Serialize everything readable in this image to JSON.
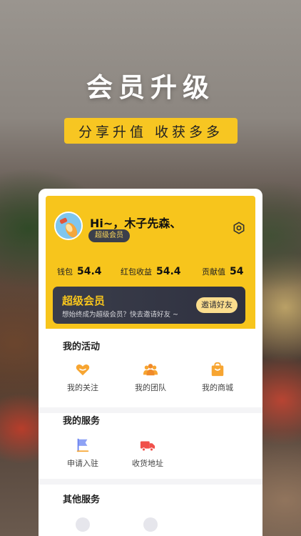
{
  "promo": {
    "headline": "会员升级",
    "tagline": "分享升值  收获多多"
  },
  "profile": {
    "greeting": "Hi~，木子先森、",
    "badge": "超级会员",
    "settings_icon": "gear-icon"
  },
  "stats": [
    {
      "label": "钱包",
      "value": "54.4"
    },
    {
      "label": "红包收益",
      "value": "54.4"
    },
    {
      "label": "贡献值",
      "value": "54"
    }
  ],
  "vip_card": {
    "title": "超级会员",
    "description": "想始终成为超级会员？快去邀请好友 ~",
    "invite_label": "邀请好友"
  },
  "activities": {
    "title": "我的活动",
    "items": [
      {
        "label": "我的关注",
        "icon": "heart-icon"
      },
      {
        "label": "我的团队",
        "icon": "team-icon"
      },
      {
        "label": "我的商城",
        "icon": "shopping-bag-icon"
      }
    ]
  },
  "services": {
    "title": "我的服务",
    "items": [
      {
        "label": "申请入驻",
        "icon": "flag-icon"
      },
      {
        "label": "收货地址",
        "icon": "delivery-truck-icon"
      }
    ]
  },
  "other_services": {
    "title": "其他服务"
  },
  "colors": {
    "accent_yellow": "#f7c51c",
    "vip_dark": "#3a3d4a",
    "icon_orange": "#f7a531",
    "icon_red": "#f0504a",
    "icon_blue": "#6a83f0"
  }
}
